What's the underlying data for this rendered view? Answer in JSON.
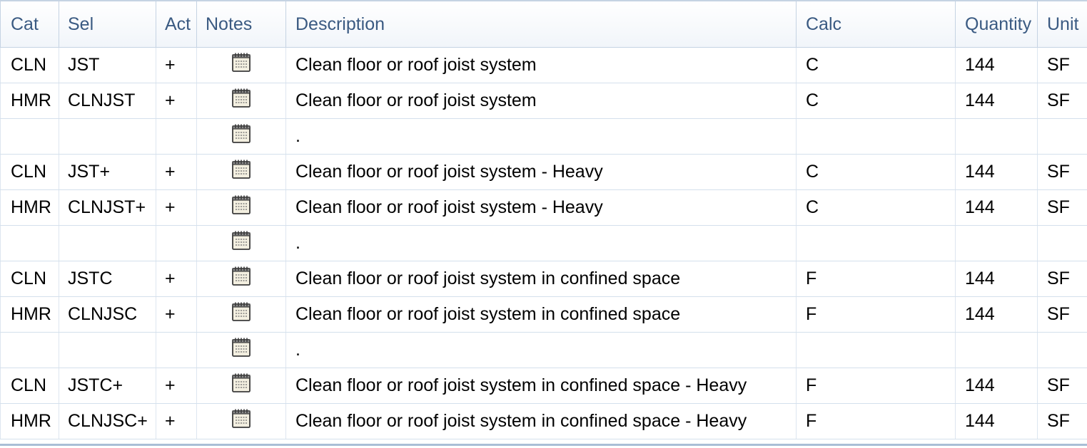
{
  "columns": {
    "cat": "Cat",
    "sel": "Sel",
    "act": "Act",
    "notes": "Notes",
    "description": "Description",
    "calc": "Calc",
    "quantity": "Quantity",
    "unit": "Unit"
  },
  "rows": [
    {
      "cat": "CLN",
      "sel": "JST",
      "act": "+",
      "notes_icon": "notepad-icon",
      "description": "Clean floor or roof joist system",
      "calc": "C",
      "quantity": "144",
      "unit": "SF"
    },
    {
      "cat": "HMR",
      "sel": "CLNJST",
      "act": "+",
      "notes_icon": "notepad-icon",
      "description": "Clean floor or roof joist system",
      "calc": "C",
      "quantity": "144",
      "unit": "SF"
    },
    {
      "cat": "",
      "sel": "",
      "act": "",
      "notes_icon": "notepad-icon",
      "description": ".",
      "calc": "",
      "quantity": "",
      "unit": ""
    },
    {
      "cat": "CLN",
      "sel": "JST+",
      "act": "+",
      "notes_icon": "notepad-icon",
      "description": "Clean floor or roof joist system - Heavy",
      "calc": "C",
      "quantity": "144",
      "unit": "SF"
    },
    {
      "cat": "HMR",
      "sel": "CLNJST+",
      "act": "+",
      "notes_icon": "notepad-icon",
      "description": "Clean floor or roof joist system - Heavy",
      "calc": "C",
      "quantity": "144",
      "unit": "SF"
    },
    {
      "cat": "",
      "sel": "",
      "act": "",
      "notes_icon": "notepad-icon",
      "description": ".",
      "calc": "",
      "quantity": "",
      "unit": ""
    },
    {
      "cat": "CLN",
      "sel": "JSTC",
      "act": "+",
      "notes_icon": "notepad-icon",
      "description": "Clean floor or roof joist system in confined space",
      "calc": "F",
      "quantity": "144",
      "unit": "SF"
    },
    {
      "cat": "HMR",
      "sel": "CLNJSC",
      "act": "+",
      "notes_icon": "notepad-icon",
      "description": "Clean floor or roof joist system in confined space",
      "calc": "F",
      "quantity": "144",
      "unit": "SF"
    },
    {
      "cat": "",
      "sel": "",
      "act": "",
      "notes_icon": "notepad-icon",
      "description": ".",
      "calc": "",
      "quantity": "",
      "unit": ""
    },
    {
      "cat": "CLN",
      "sel": "JSTC+",
      "act": "+",
      "notes_icon": "notepad-icon",
      "description": "Clean floor or roof joist system in confined space - Heavy",
      "calc": "F",
      "quantity": "144",
      "unit": "SF"
    },
    {
      "cat": "HMR",
      "sel": "CLNJSC+",
      "act": "+",
      "notes_icon": "notepad-icon",
      "description": "Clean floor or roof joist system in confined space - Heavy",
      "calc": "F",
      "quantity": "144",
      "unit": "SF"
    }
  ],
  "colors": {
    "header_text": "#3a5a82",
    "grid_line": "#c5d3e3",
    "cell_text": "#000000"
  }
}
